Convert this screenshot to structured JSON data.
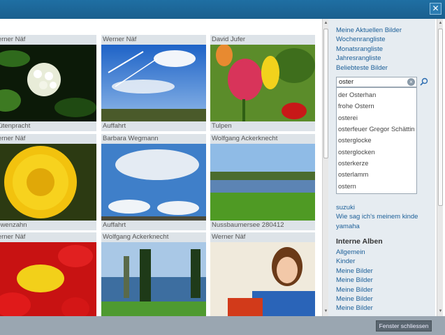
{
  "header": {
    "close_glyph": "✕"
  },
  "photos": [
    {
      "author": "Werner Näf",
      "title": "Blütenpracht"
    },
    {
      "author": "Werner Näf",
      "title": "Auffahrt"
    },
    {
      "author": "David Jufer",
      "title": "Tulpen"
    },
    {
      "author": "Werner Näf",
      "title": "Löwenzahn"
    },
    {
      "author": "Barbara Wegmann",
      "title": "Auffahrt"
    },
    {
      "author": "Wolfgang Ackerknecht",
      "title": "Nussbaumersee 280412"
    },
    {
      "author": "Werner Näf",
      "title": ""
    },
    {
      "author": "Wolfgang Ackerknecht",
      "title": ""
    },
    {
      "author": "Werner Näf",
      "title": ""
    }
  ],
  "sidebar": {
    "nav_links": [
      "Meine Aktuellen Bilder",
      "Wochenrangliste",
      "Monatsrangliste",
      "Jahresrangliste",
      "Beliebteste Bilder"
    ],
    "search": {
      "value": "oster",
      "clear_glyph": "×"
    },
    "suggestions": [
      "der Osterhan",
      "frohe Ostern",
      "osterei",
      "osterfeuer Gregor Schättin",
      "osterglocke",
      "osterglocken",
      "osterkerze",
      "osterlamm",
      "ostern"
    ],
    "tags": [
      "suzuki",
      "Wie sag ich's meinem kinde",
      "yamaha"
    ],
    "albums_title": "Interne Alben",
    "albums": [
      "Allgemein",
      "Kinder",
      "Meine Bilder",
      "Meine Bilder",
      "Meine Bilder",
      "Meine Bilder",
      "Meine Bilder"
    ]
  },
  "footer": {
    "close_label": "Fenster schliessen"
  },
  "colors": {
    "link": "#1c5f98",
    "titlebar": "#1f6fa3",
    "panel": "#e6ecf1"
  }
}
